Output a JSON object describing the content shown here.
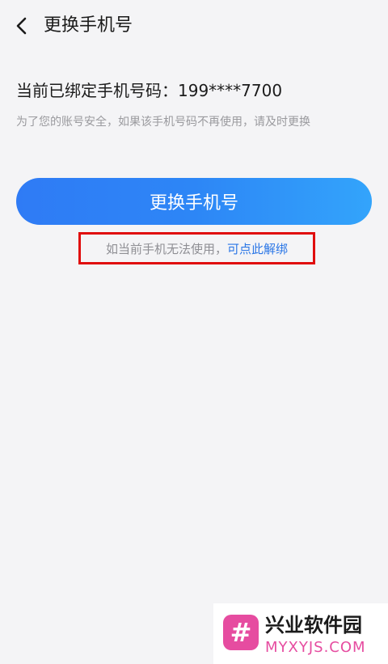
{
  "header": {
    "back_icon": "chevron-left-icon",
    "title": "更换手机号"
  },
  "bound": {
    "text": "当前已绑定手机号码：199****7700",
    "hint": "为了您的账号安全，如果该手机号码不再使用，请及时更换"
  },
  "actions": {
    "change_label": "更换手机号",
    "unbind_prefix": "如当前手机无法使用，",
    "unbind_link": "可点此解绑"
  },
  "colors": {
    "button_start": "#2f7bf5",
    "button_end": "#33a4fb",
    "link": "#2a76e6",
    "highlight_box": "#e00d0d",
    "watermark_accent": "#e64ca0"
  },
  "watermark": {
    "logo_icon": "hash-logo-icon",
    "title": "兴业软件园",
    "url": "MYXYJS.COM"
  }
}
